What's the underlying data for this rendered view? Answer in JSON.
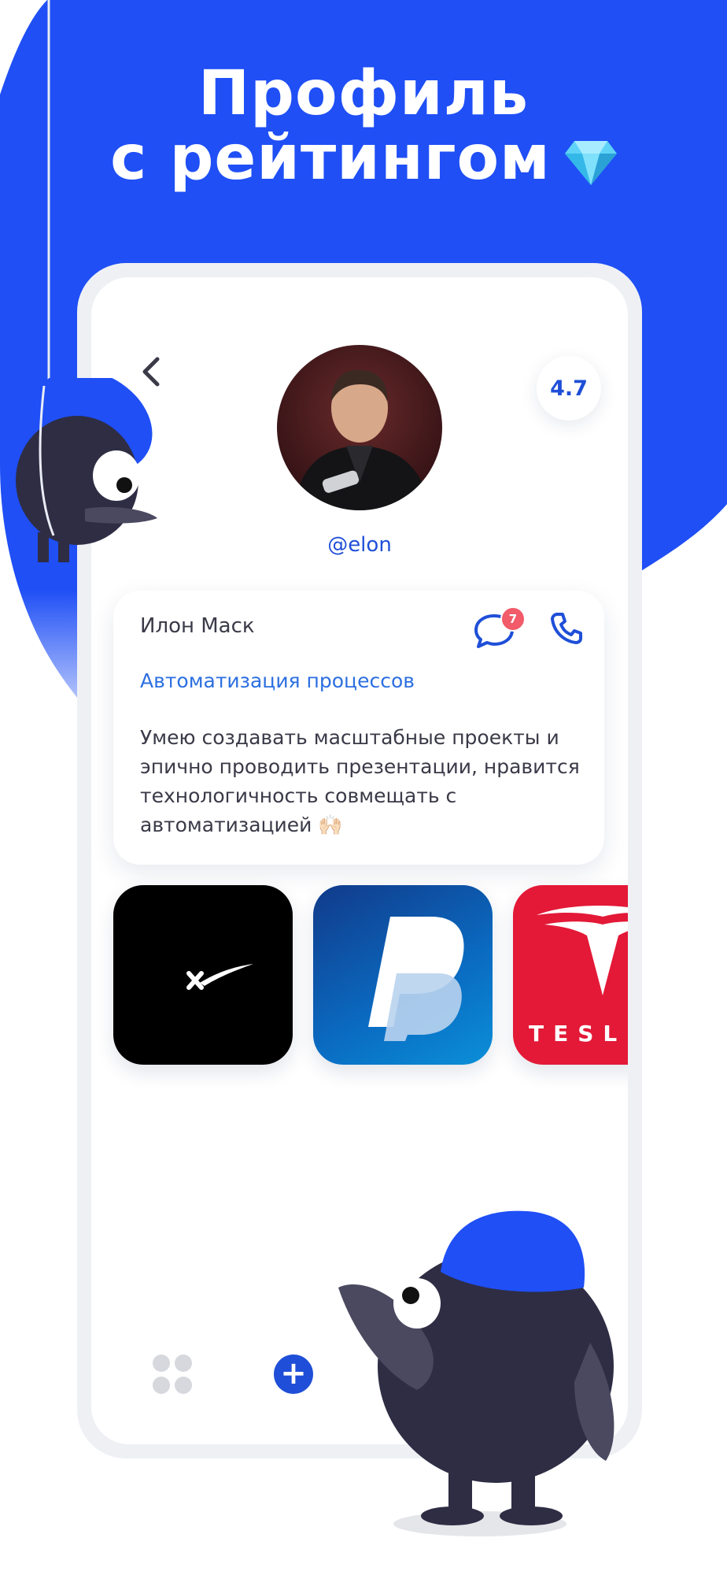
{
  "headline": {
    "line1": "Профиль",
    "line2": "с рейтингом"
  },
  "colors": {
    "brand_blue": "#1f4fd8",
    "card_text": "#3a3a48",
    "role_text": "#2c6fe0",
    "badge_red": "#f15b6a"
  },
  "profile": {
    "rating": "4.7",
    "username": "@elon",
    "name": "Илон Маск",
    "role": "Автоматизация процессов",
    "bio": "Умею создавать масштабные проекты и эпично проводить презентации, нравится технологичность совмещать с автоматизацией 🙌🏻",
    "messages_badge": "7"
  },
  "companies": [
    {
      "name": "SpaceX",
      "color": "#000000"
    },
    {
      "name": "PayPal",
      "color": "#0a6cc2"
    },
    {
      "name": "Tesla",
      "color": "#e31937"
    }
  ],
  "tesla_wordmark": "TESL",
  "bottom_nav": {
    "icons": [
      "apps-grid-icon",
      "add-icon"
    ],
    "add_label": "+"
  }
}
